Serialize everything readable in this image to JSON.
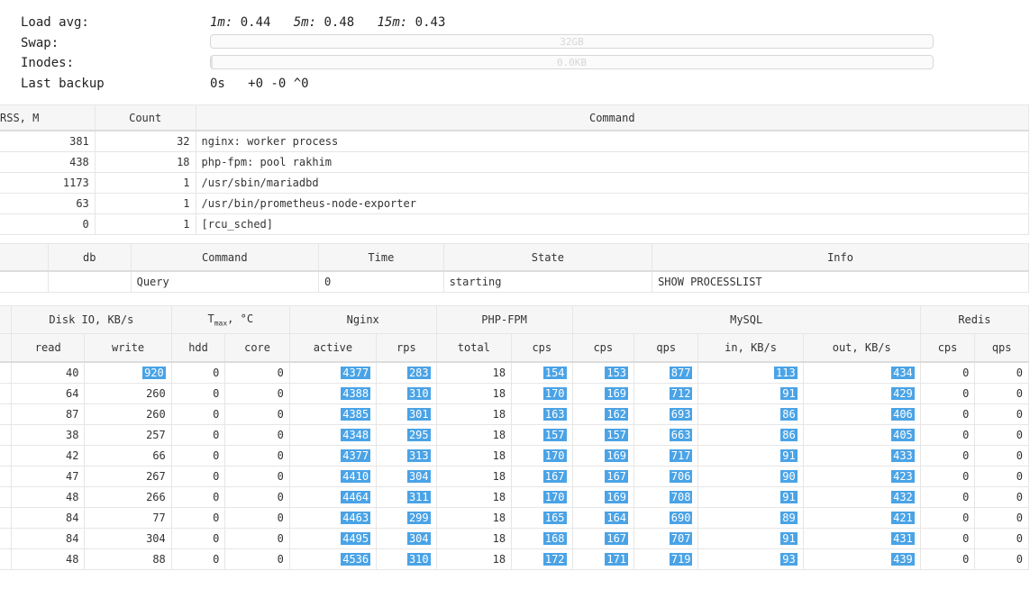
{
  "summary": {
    "load_label": "Load avg:",
    "load_1m_label": "1m:",
    "load_1m": "0.44",
    "load_5m_label": "5m:",
    "load_5m": "0.48",
    "load_15m_label": "15m:",
    "load_15m": "0.43",
    "swap_label": "Swap:",
    "swap_text": "32GB",
    "swap_fraction": 0.0,
    "inodes_label": "Inodes:",
    "inodes_text": "0.0KB",
    "inodes_fraction": 0.003,
    "backup_label": "Last backup",
    "backup_value": "0s   +0 -0 ^0"
  },
  "processes": {
    "headers": [
      "RSS, M",
      "Count",
      "Command"
    ],
    "rows": [
      [
        "381",
        "32",
        "nginx: worker process"
      ],
      [
        "438",
        "18",
        "php-fpm: pool rakhim"
      ],
      [
        "1173",
        "1",
        "/usr/sbin/mariadbd"
      ],
      [
        "63",
        "1",
        "/usr/bin/prometheus-node-exporter"
      ],
      [
        "0",
        "1",
        "[rcu_sched]"
      ]
    ]
  },
  "mysql_processlist": {
    "headers": [
      "",
      "db",
      "Command",
      "Time",
      "State",
      "Info"
    ],
    "rows": [
      [
        "",
        "",
        "Query",
        "0",
        "starting",
        "SHOW PROCESSLIST"
      ]
    ]
  },
  "stats": {
    "groups": [
      "",
      "Disk IO, KB/s",
      "T",
      "max",
      ", °C",
      "Nginx",
      "PHP-FPM",
      "MySQL",
      "Redis"
    ],
    "subheaders": [
      "",
      "read",
      "write",
      "hdd",
      "core",
      "active",
      "rps",
      "total",
      "cps",
      "cps",
      "qps",
      "in, KB/s",
      "out, KB/s",
      "cps",
      "qps"
    ],
    "highlight_color": "#4aa3e6",
    "rows": [
      [
        "40",
        "920",
        "0",
        "0",
        "4377",
        "283",
        "18",
        "154",
        "153",
        "877",
        "113",
        "434",
        "0",
        "0"
      ],
      [
        "64",
        "260",
        "0",
        "0",
        "4388",
        "310",
        "18",
        "170",
        "169",
        "712",
        "91",
        "429",
        "0",
        "0"
      ],
      [
        "87",
        "260",
        "0",
        "0",
        "4385",
        "301",
        "18",
        "163",
        "162",
        "693",
        "86",
        "406",
        "0",
        "0"
      ],
      [
        "38",
        "257",
        "0",
        "0",
        "4348",
        "295",
        "18",
        "157",
        "157",
        "663",
        "86",
        "405",
        "0",
        "0"
      ],
      [
        "42",
        "66",
        "0",
        "0",
        "4377",
        "313",
        "18",
        "170",
        "169",
        "717",
        "91",
        "433",
        "0",
        "0"
      ],
      [
        "47",
        "267",
        "0",
        "0",
        "4410",
        "304",
        "18",
        "167",
        "167",
        "706",
        "90",
        "423",
        "0",
        "0"
      ],
      [
        "48",
        "266",
        "0",
        "0",
        "4464",
        "311",
        "18",
        "170",
        "169",
        "708",
        "91",
        "432",
        "0",
        "0"
      ],
      [
        "84",
        "77",
        "0",
        "0",
        "4463",
        "299",
        "18",
        "165",
        "164",
        "690",
        "89",
        "421",
        "0",
        "0"
      ],
      [
        "84",
        "304",
        "0",
        "0",
        "4495",
        "304",
        "18",
        "168",
        "167",
        "707",
        "91",
        "431",
        "0",
        "0"
      ],
      [
        "48",
        "88",
        "0",
        "0",
        "4536",
        "310",
        "18",
        "172",
        "171",
        "719",
        "93",
        "439",
        "0",
        "0"
      ]
    ],
    "highlight_rows": [
      [
        false,
        true,
        false,
        false,
        true,
        true,
        false,
        true,
        true,
        true,
        true,
        true,
        false,
        false
      ],
      [
        false,
        false,
        false,
        false,
        true,
        true,
        false,
        true,
        true,
        true,
        true,
        true,
        false,
        false
      ]
    ]
  }
}
